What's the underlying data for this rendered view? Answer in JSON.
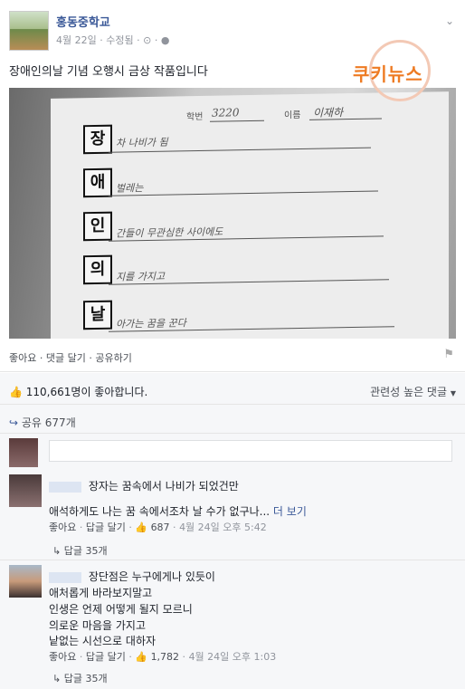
{
  "post": {
    "page_name": "홍동중학교",
    "date": "4월 22일",
    "edited": "수정됨",
    "meta_sep": "·",
    "caption": "장애인의날 기념 오행시 금상 작품입니다"
  },
  "photo": {
    "student_no_label": "학번",
    "student_no": "3220",
    "name_label": "이름",
    "name": "이재하",
    "rows": [
      {
        "char": "장",
        "text": "차 나비가 됨"
      },
      {
        "char": "애",
        "text": "벌레는"
      },
      {
        "char": "인",
        "text": "간들이 무관심한 사이에도"
      },
      {
        "char": "의",
        "text": "지를 가지고"
      },
      {
        "char": "날",
        "text": "아가는 꿈을 꾼다"
      }
    ],
    "watermark": "쿠키뉴스"
  },
  "actions": {
    "like": "좋아요",
    "comment": "댓글 달기",
    "share": "공유하기",
    "sep": "·"
  },
  "stats": {
    "likes": "110,661명이 좋아합니다.",
    "sort": "관련성 높은 댓글",
    "shares": "공유 677개"
  },
  "comments": [
    {
      "lines": [
        "장자는 꿈속에서 나비가 되었건만",
        "",
        "애석하게도 나는 꿈 속에서조차 날 수가 없구나..."
      ],
      "see_more": "더 보기",
      "like": "좋아요",
      "reply": "답글 달기",
      "like_count": "687",
      "time": "4월 24일 오후 5:42",
      "reply_count": "답글 35개"
    },
    {
      "lines": [
        "장단점은 누구에게나 있듯이",
        "애처롭게 바라보지말고",
        "인생은 언제 어떻게 될지 모르니",
        "의로운 마음을 가지고",
        "낱없는 시선으로 대하자"
      ],
      "like": "좋아요",
      "reply": "답글 달기",
      "like_count": "1,782",
      "time": "4월 24일 오후 1:03",
      "reply_count": "답글 35개"
    }
  ]
}
